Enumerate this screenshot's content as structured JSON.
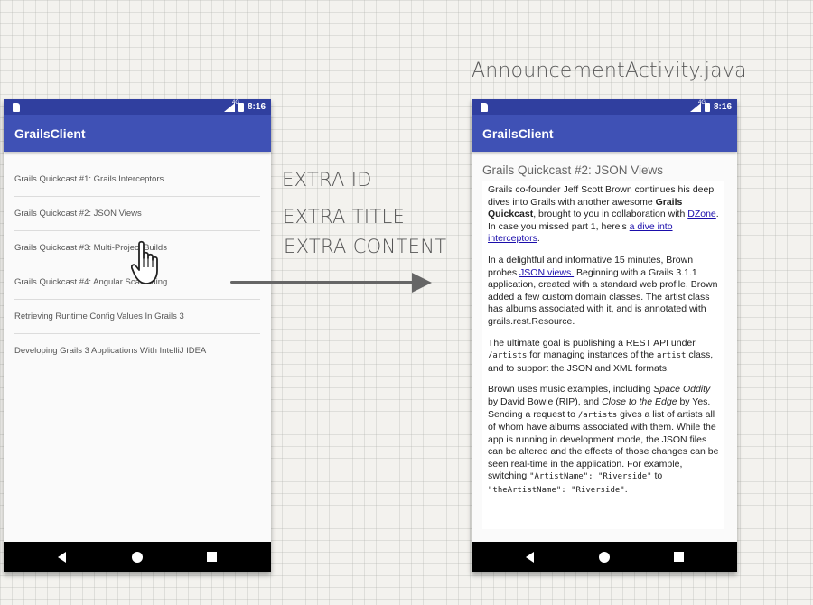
{
  "heading": "AnnouncementActivity.java",
  "status_bar": {
    "network": "4G",
    "time": "8:16"
  },
  "app_title": "GrailsClient",
  "list_items": [
    "Grails Quickcast #1: Grails Interceptors",
    "Grails Quickcast #2: JSON Views",
    "Grails Quickcast #3: Multi-Project Builds",
    "Grails Quickcast #4: Angular Scaffolding",
    "Retrieving Runtime Config Values In Grails 3",
    "Developing Grails 3 Applications With IntelliJ IDEA"
  ],
  "extras": [
    "EXTRA ID",
    "EXTRA TITLE",
    "EXTRA CONTENT"
  ],
  "detail": {
    "title": "Grails Quickcast #2: JSON Views",
    "p1": {
      "a": "Grails co-founder Jeff Scott Brown continues his deep dives into Grails with another awesome ",
      "bold": "Grails Quickcast",
      "b": ", brought to you in collaboration with ",
      "link1": "DZone",
      "c": ". In case you missed part 1, here's ",
      "link2": "a dive into interceptors",
      "d": "."
    },
    "p2": {
      "a": "In a delightful and informative 15 minutes, Brown probes ",
      "link": "JSON views.",
      "b": " Beginning with a Grails 3.1.1 application, created with a standard web profile, Brown added a few custom domain classes. The artist class has albums associated with it, and is annotated with grails.rest.Resource."
    },
    "p3": {
      "a": "The ultimate goal is publishing a REST API under ",
      "code1": "/artists",
      "b": " for managing instances of the ",
      "code2": "artist",
      "c": " class, and to support the JSON and XML formats."
    },
    "p4": {
      "a": "Brown uses music examples, including ",
      "em1": "Space Oddity",
      "b": " by David Bowie (RIP), and ",
      "em2": "Close to the Edge",
      "c": " by Yes. Sending a request to ",
      "code1": "/artists",
      "d": " gives a list of artists all of whom have albums associated with them. While the app is running in development mode, the JSON files can be altered and the effects of those changes can be seen real-time in the application. For example, switching ",
      "code2": "\"ArtistName\": \"Riverside\"",
      "e": " to ",
      "code3": "\"theArtistName\": \"Riverside\"",
      "f": "."
    }
  },
  "icons": [
    "hand-pointer-icon",
    "arrow-right-icon",
    "back-icon",
    "home-icon",
    "recents-icon"
  ]
}
